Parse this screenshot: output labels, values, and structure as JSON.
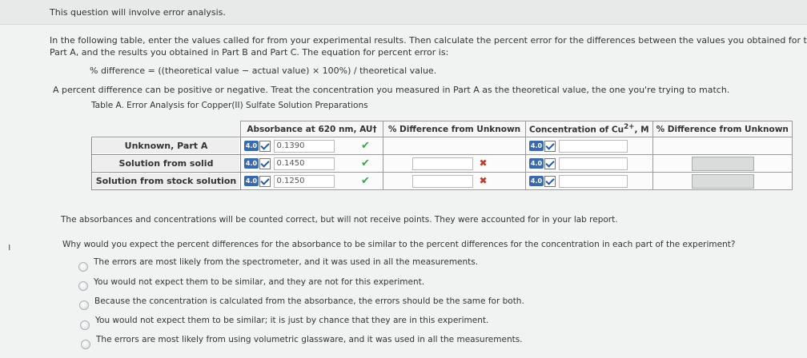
{
  "header": {
    "intro": "This question will involve error analysis."
  },
  "instructions": {
    "line1": "In the following table, enter the values called for from your experimental results. Then calculate the percent error for the differences between the values you obtained for th",
    "line2": "Part A, and the results you obtained in Part B and Part C. The equation for percent error is:",
    "formula": "% difference = ((theoretical value − actual value) × 100%) / theoretical value.",
    "note": "A percent difference can be positive or negative. Treat the concentration you measured in Part A as the theoretical value, the one you're trying to match."
  },
  "table": {
    "caption": "Table A. Error Analysis for Copper(II) Sulfate Solution Preparations",
    "headers": {
      "absorbance": "Absorbance at 620 nm, AU†",
      "pct_diff_1": "% Difference from Unknown",
      "concentration": "Concentration of Cu2+, M",
      "pct_diff_2": "% Difference from Unknown"
    },
    "badge": "4.0",
    "rows": [
      {
        "label": "Unknown, Part A",
        "absorbance": "0.1390"
      },
      {
        "label": "Solution from solid",
        "absorbance": "0.1450"
      },
      {
        "label": "Solution from stock solution",
        "absorbance": "0.1250"
      }
    ],
    "marks": {
      "correct": "✔",
      "incorrect": "✖"
    }
  },
  "note_counted": "The absorbances and concentrations will be counted correct, but will not receive points. They were accounted for in your lab report.",
  "question": {
    "prompt": "Why would you expect the percent differences for the absorbance to be similar to the percent differences for the concentration in each part of the experiment?",
    "options": [
      "The errors are most likely from the spectrometer, and it was used in all the measurements.",
      "You would not expect them to be similar, and they are not for this experiment.",
      "Because the concentration is calculated from the absorbance, the errors should be the same for both.",
      "You would not expect them to be similar; it is just by chance that they are in this experiment.",
      "The errors are most likely from using volumetric glassware, and it was used in all the measurements."
    ]
  },
  "margin_mark": "ı"
}
